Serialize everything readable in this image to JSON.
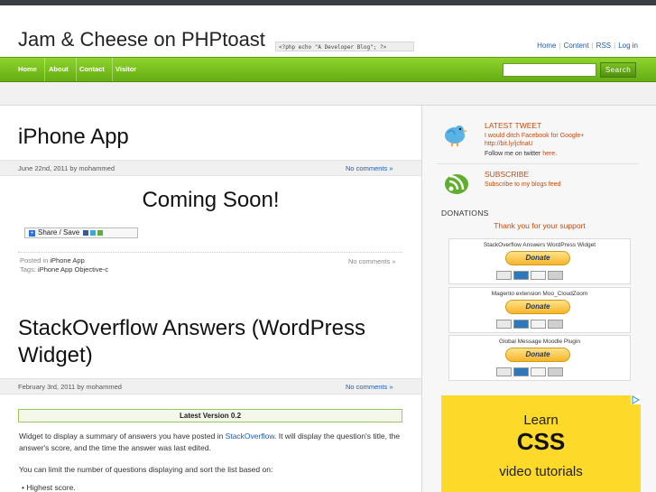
{
  "header": {
    "site_title": "Jam & Cheese on PHPtoast",
    "php_tagline": "<?php echo \"A Developer Blog\"; ?>",
    "top_links": [
      "Home",
      "Content",
      "RSS",
      "Log in"
    ]
  },
  "nav": {
    "items": [
      "Home",
      "About",
      "Contact",
      "Visitor"
    ],
    "search_placeholder": "",
    "search_button": "Search"
  },
  "post1": {
    "title": "iPhone App",
    "meta": "June 22nd, 2011 by mohammed",
    "comments_link": "No comments »",
    "coming_soon": "Coming Soon!",
    "share_label": "Share / Save",
    "posted_in_label": "Posted in",
    "posted_in_value": "iPhone App",
    "tags_label": "Tags:",
    "tags_value": "iPhone App  Objective-c",
    "footer_comments": "No comments »"
  },
  "post2": {
    "title_line1": "StackOverflow Answers (WordPress",
    "title_line2": "Widget)",
    "meta": "February 3rd, 2011 by mohammed",
    "comments_link": "No comments »",
    "latest_version": "Latest Version 0.2",
    "para1_pre": "Widget to display a summary of answers you have posted in ",
    "para1_link": "StackOverflow",
    "para1_post": ". It will display the question's title, the answer's score, and the time the answer was last edited.",
    "para2": "You can limit the number of questions displaying and sort the list based on:",
    "bullet1": "Highest score."
  },
  "sidebar": {
    "tweet_head": "LATEST TWEET",
    "tweet_text_1": "I would ditch Facebook for Google+",
    "tweet_text_2": "http://bit.ly/jcfnaU",
    "follow_pre": "Follow me on twitter ",
    "follow_link": "here",
    "follow_post": ".",
    "subscribe_head": "SUBSCRIBE",
    "subscribe_text": "Subscribe to my blogs feed",
    "donations_head": "DONATIONS",
    "thanks": "Thank you for your support",
    "donate_items": [
      {
        "label": "StackOverflow Answers WordPress Widget",
        "button": "Donate"
      },
      {
        "label": "Magento extension Moo_CloudZoom",
        "button": "Donate"
      },
      {
        "label": "Global Message Moodle Plugin",
        "button": "Donate"
      }
    ],
    "ad": {
      "line1": "Learn",
      "line2": "CSS",
      "line3": "video tutorials"
    }
  },
  "colors": {
    "nav_green": "#64ad13",
    "accent_orange": "#c94a0b",
    "link_blue": "#1f5bb5",
    "ad_yellow": "#fdd92a"
  },
  "icons": [
    "twitter-bird-icon",
    "rss-feed-icon",
    "share-plus-icon",
    "adchoices-icon"
  ]
}
